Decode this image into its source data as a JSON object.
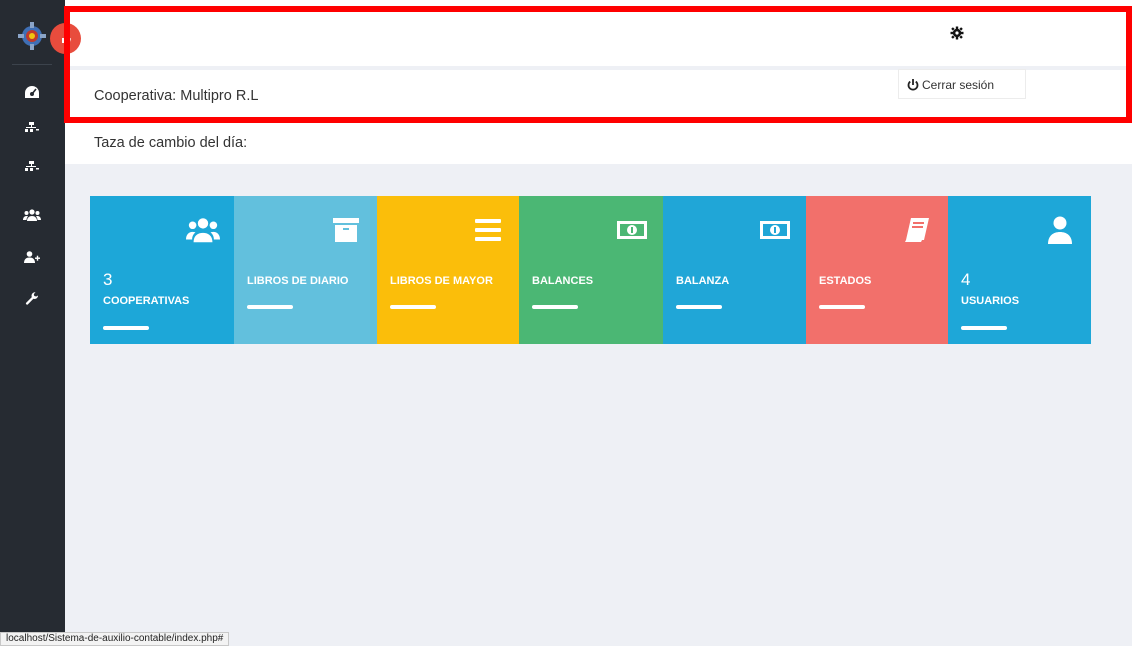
{
  "header": {
    "cooperative_label": "Cooperativa: Multipro R.L",
    "exchange_rate_label": "Taza de cambio del día:"
  },
  "user_menu": {
    "logout_label": "Cerrar sesión"
  },
  "tiles": [
    {
      "count": "3",
      "label": "COOPERATIVAS",
      "color": "#1da7d8",
      "icon": "users-icon"
    },
    {
      "count": "",
      "label": "LIBROS DE DIARIO",
      "color": "#62c0dd",
      "icon": "archive-box-icon"
    },
    {
      "count": "",
      "label": "LIBROS DE MAYOR",
      "color": "#fbbe0a",
      "icon": "bars-icon"
    },
    {
      "count": "",
      "label": "BALANCES",
      "color": "#4bb774",
      "icon": "banknote-icon"
    },
    {
      "count": "",
      "label": "BALANZA",
      "color": "#20a6d7",
      "icon": "banknote-icon"
    },
    {
      "count": "",
      "label": "ESTADOS",
      "color": "#f2706b",
      "icon": "book-icon"
    },
    {
      "count": "4",
      "label": "USUARIOS",
      "color": "#1ea7d8",
      "icon": "user-icon"
    }
  ],
  "sidebar": {
    "items": [
      "dashboard-icon",
      "sitemap-icon",
      "sitemap-icon",
      "users-icon",
      "user-plus-icon",
      "wrench-icon"
    ]
  },
  "status_bar": {
    "url": "localhost/Sistema-de-auxilio-contable/index.php#"
  },
  "colors": {
    "sidebar": "#262b32",
    "toggle": "#e84c3d",
    "highlight": "#ff0000",
    "background": "#eef0f5"
  }
}
